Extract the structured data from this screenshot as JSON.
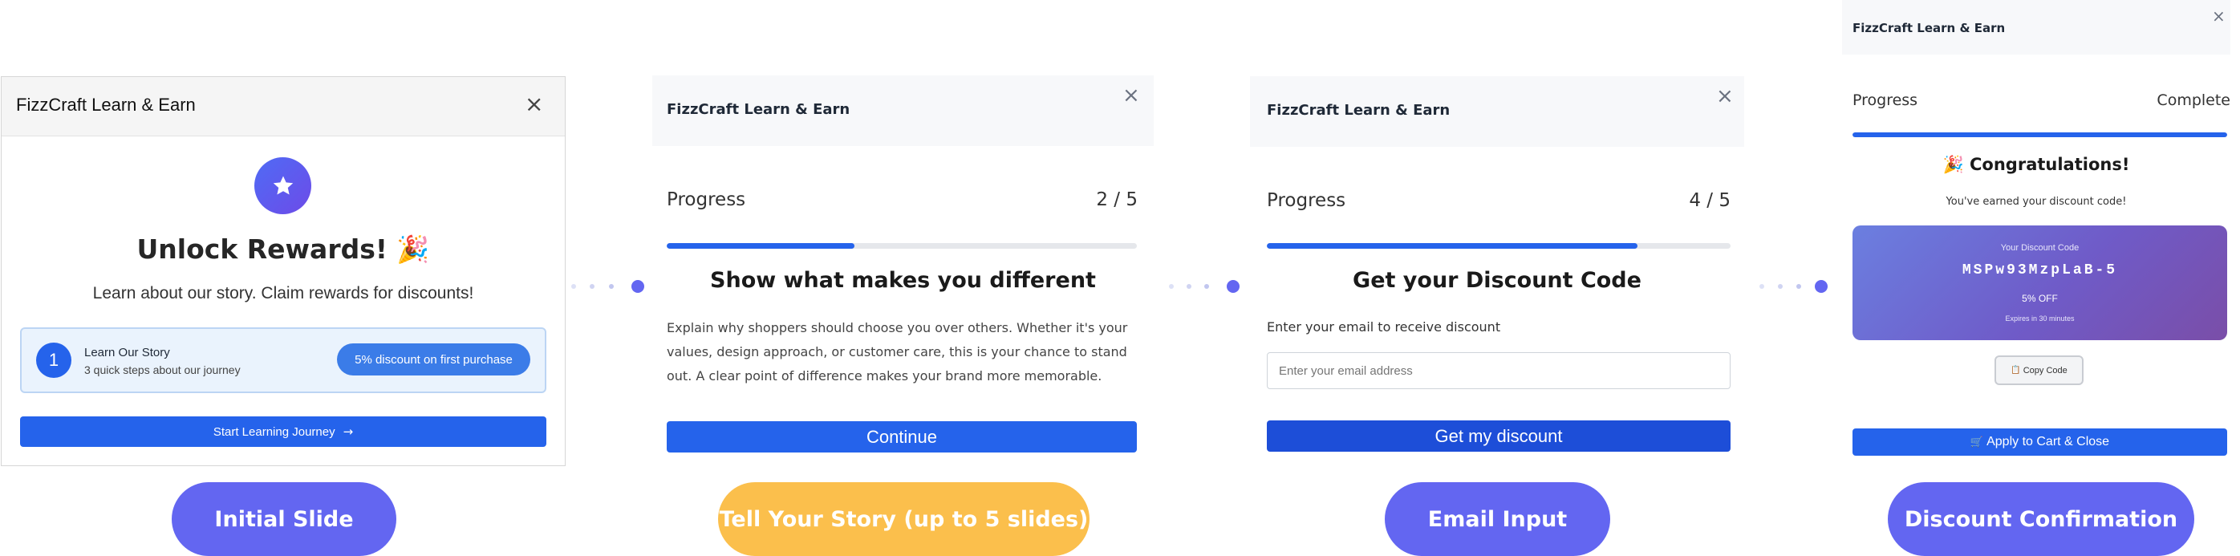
{
  "slide1": {
    "title": "FizzCraft Learn & Earn",
    "close": "×",
    "star_icon": "star-icon",
    "heading": "Unlock Rewards! 🎉",
    "subtitle": "Learn about our story. Claim rewards for discounts!",
    "step_number": "1",
    "step_title": "Learn Our Story",
    "step_desc": "3 quick steps about our journey",
    "reward_badge": "5% discount on first purchase",
    "cta": "Start Learning Journey",
    "cta_icon": "→"
  },
  "slide2": {
    "title": "FizzCraft Learn & Earn",
    "close": "×",
    "progress_label": "Progress",
    "progress_count": "2 / 5",
    "progress_value": 0.4,
    "heading": "Show what makes you different",
    "body": "Explain why shoppers should choose you over others. Whether it's your values, design approach, or customer care, this is your chance to stand out. A clear point of difference makes your brand more memorable.",
    "cta": "Continue"
  },
  "slide3": {
    "title": "FizzCraft Learn & Earn",
    "close": "×",
    "progress_label": "Progress",
    "progress_count": "4 / 5",
    "progress_value": 0.8,
    "heading": "Get your Discount Code",
    "email_label": "Enter your email to receive discount",
    "email_placeholder": "Enter your email address",
    "cta": "Get my discount"
  },
  "slide4": {
    "title": "FizzCraft Learn & Earn",
    "close": "×",
    "progress_label": "Progress",
    "progress_status": "Complete",
    "progress_value": 1.0,
    "heading": "🎉 Congratulations!",
    "subtitle": "You've earned your discount code!",
    "code_label": "Your Discount Code",
    "code": "MSPw93MzpLaB-5",
    "code_value": "5% OFF",
    "code_expiry": "Expires in 30 minutes",
    "copy_icon": "📋",
    "copy": "Copy Code",
    "apply_icon": "🛒",
    "apply": "Apply to Cart & Close"
  },
  "labels": {
    "initial": "Initial Slide",
    "story": "Tell Your Story (up to 5 slides)",
    "email": "Email Input",
    "discount": "Discount Confirmation"
  },
  "colors": {
    "primary": "#2563eb",
    "pill_purple": "#6366f1",
    "pill_orange": "#fbbf4c",
    "connector": "#6366f1"
  }
}
